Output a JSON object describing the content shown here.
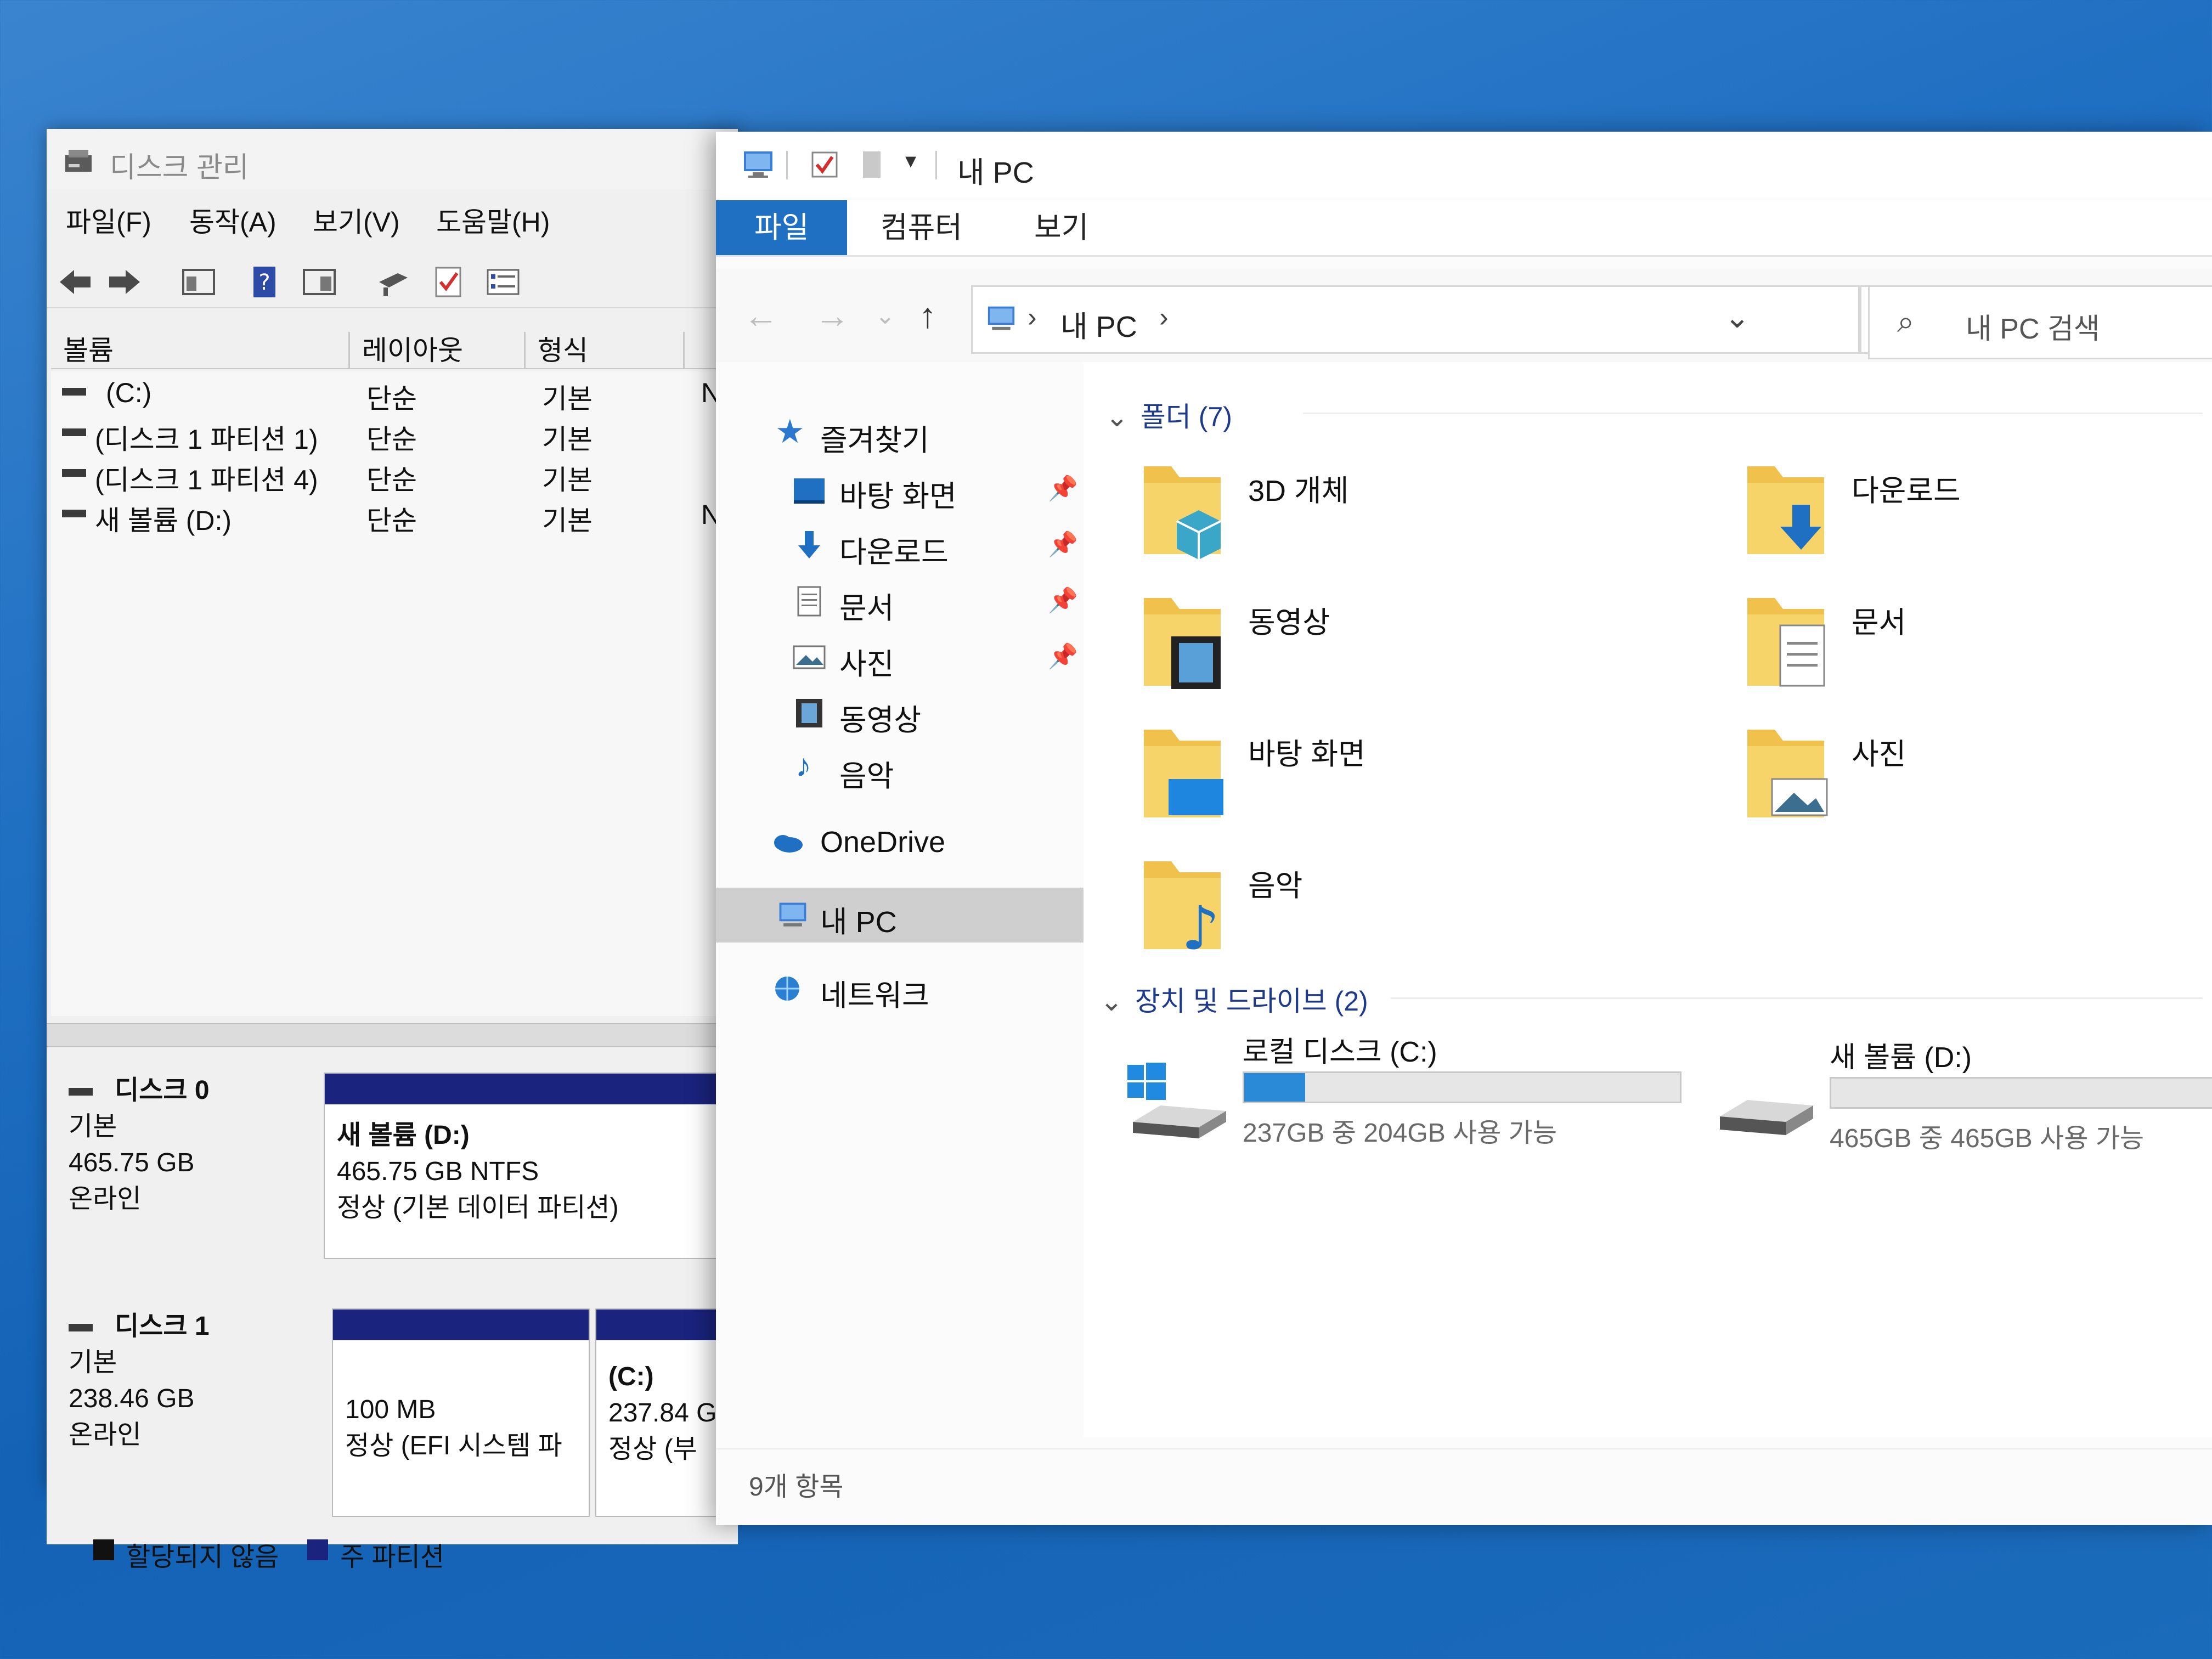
{
  "disk_mgmt": {
    "title": "디스크 관리",
    "menu": [
      "파일(F)",
      "동작(A)",
      "보기(V)",
      "도움말(H)"
    ],
    "columns": [
      "볼륨",
      "레이아웃",
      "형식"
    ],
    "volumes": [
      {
        "name": "(C:)",
        "layout": "단순",
        "type": "기본",
        "extra": "N"
      },
      {
        "name": "(디스크 1 파티션 1)",
        "layout": "단순",
        "type": "기본",
        "extra": ""
      },
      {
        "name": "(디스크 1 파티션 4)",
        "layout": "단순",
        "type": "기본",
        "extra": ""
      },
      {
        "name": "새 볼륨 (D:)",
        "layout": "단순",
        "type": "기본",
        "extra": "N"
      }
    ],
    "disks": [
      {
        "name": "디스크 0",
        "kind": "기본",
        "size": "465.75 GB",
        "status": "온라인",
        "partitions": [
          {
            "label": "새 볼륨  (D:)",
            "size": "465.75 GB NTFS",
            "status": "정상 (기본 데이터 파티션)"
          }
        ]
      },
      {
        "name": "디스크 1",
        "kind": "기본",
        "size": "238.46 GB",
        "status": "온라인",
        "partitions": [
          {
            "label": "",
            "size": "100 MB",
            "status": "정상 (EFI 시스템 파"
          },
          {
            "label": "(C:)",
            "size": "237.84 G",
            "status": "정상 (부"
          }
        ]
      }
    ],
    "legend": [
      {
        "label": "할당되지 않음",
        "color": "#111111"
      },
      {
        "label": "주 파티션",
        "color": "#1a237e"
      }
    ]
  },
  "explorer": {
    "title": "내 PC",
    "ribbon_tabs": [
      "파일",
      "컴퓨터",
      "보기"
    ],
    "address": {
      "crumb": "내 PC"
    },
    "search_placeholder": "내 PC 검색",
    "nav": {
      "quick_access": "즐겨찾기",
      "pinned": [
        "바탕 화면",
        "다운로드",
        "문서",
        "사진"
      ],
      "others": [
        "동영상",
        "음악"
      ],
      "onedrive": "OneDrive",
      "thispc": "내 PC",
      "network": "네트워크"
    },
    "folders_header": "폴더 (7)",
    "folders": [
      "3D 개체",
      "다운로드",
      "동영상",
      "문서",
      "바탕 화면",
      "사진",
      "음악"
    ],
    "drives_header": "장치 및 드라이브 (2)",
    "drives": [
      {
        "name": "로컬 디스크 (C:)",
        "free_text": "237GB 중 204GB 사용 가능",
        "used_fraction": 0.14
      },
      {
        "name": "새 볼륨 (D:)",
        "free_text": "465GB 중 465GB 사용 가능",
        "used_fraction": 0.0
      }
    ],
    "status": "9개 항목"
  },
  "colors": {
    "accent": "#1f6fc2",
    "partition_header": "#1a237e",
    "drive_fill": "#2b8ad8",
    "folder": "#f0c14b"
  }
}
